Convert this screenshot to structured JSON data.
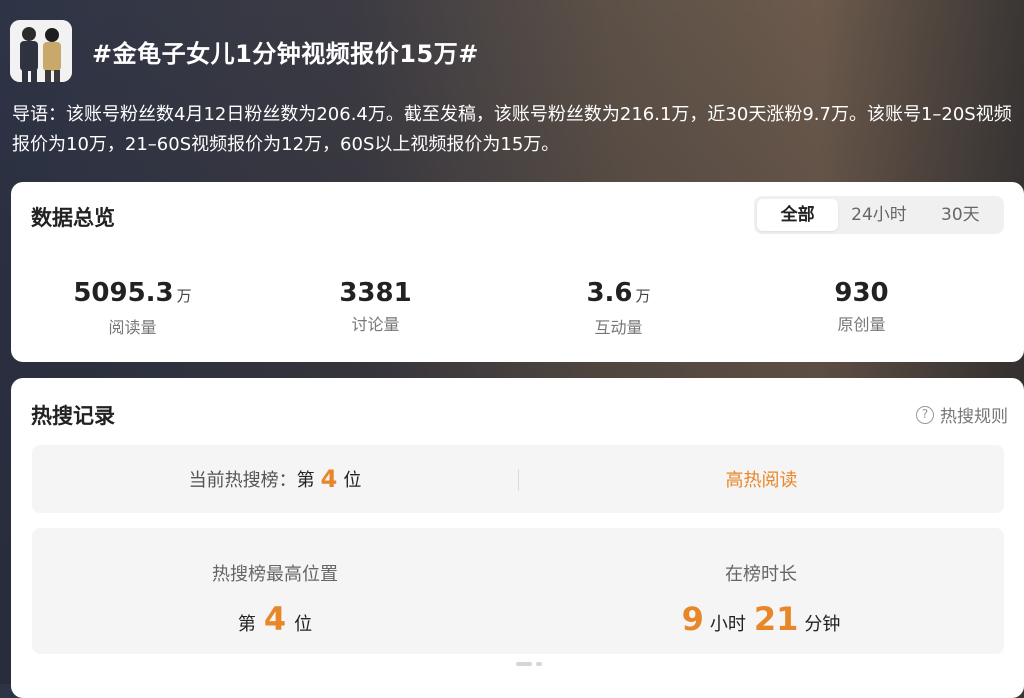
{
  "topic": {
    "title": "#金龟子女儿1分钟视频报价15万#",
    "intro": "导语：该账号粉丝数4月12日粉丝数为206.4万。截至发稿，该账号粉丝数为216.1万，近30天涨粉9.7万。该账号1–20S视频报价为10万，21–60S视频报价为12万，60S以上视频报价为15万。"
  },
  "overview": {
    "title": "数据总览",
    "tabs": [
      {
        "label": "全部",
        "active": true
      },
      {
        "label": "24小时",
        "active": false
      },
      {
        "label": "30天",
        "active": false
      }
    ],
    "stats": [
      {
        "value": "5095.3",
        "unit": "万",
        "label": "阅读量"
      },
      {
        "value": "3381",
        "unit": "",
        "label": "讨论量"
      },
      {
        "value": "3.6",
        "unit": "万",
        "label": "互动量"
      },
      {
        "value": "930",
        "unit": "",
        "label": "原创量"
      }
    ]
  },
  "hot_search": {
    "title": "热搜记录",
    "rules_label": "热搜规则",
    "current": {
      "label": "当前热搜榜：",
      "prefix": "第",
      "rank": "4",
      "suffix": "位",
      "tag": "高热阅读"
    },
    "best": {
      "label": "热搜榜最高位置",
      "prefix": "第",
      "rank": "4",
      "suffix": "位"
    },
    "duration": {
      "label": "在榜时长",
      "hours": "9",
      "hours_unit": "小时",
      "minutes": "21",
      "minutes_unit": "分钟"
    }
  },
  "colors": {
    "accent": "#e8872a",
    "card_bg": "#ffffff",
    "box_bg": "#f5f5f5"
  },
  "icons": {
    "rules": "question-circle-icon"
  }
}
